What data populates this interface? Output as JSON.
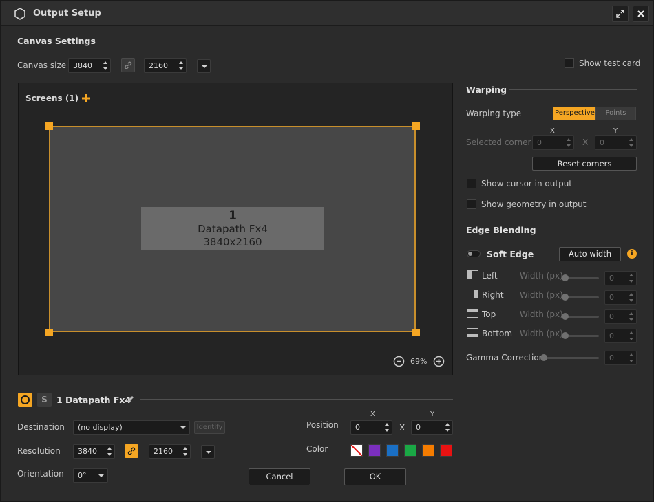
{
  "window": {
    "title": "Output Setup"
  },
  "canvas_settings": {
    "title": "Canvas Settings",
    "canvas_size_label": "Canvas size",
    "width": "3840",
    "height": "2160",
    "show_test_card_label": "Show test card"
  },
  "screens": {
    "title": "Screens (1)",
    "screen": {
      "number": "1",
      "name": "Datapath Fx4",
      "resolution": "3840x2160"
    },
    "zoom": "69%"
  },
  "warping": {
    "title": "Warping",
    "type_label": "Warping type",
    "type_options": [
      "Perspective",
      "Points"
    ],
    "selected_corner_label": "Selected corner",
    "x_header": "X",
    "y_header": "Y",
    "x_value": "0",
    "y_value": "0",
    "x_sep": "X",
    "reset_corners": "Reset corners",
    "show_cursor": "Show cursor in output",
    "show_geometry": "Show geometry in output"
  },
  "edge_blending": {
    "title": "Edge Blending",
    "soft_edge_label": "Soft Edge",
    "auto_width": "Auto width",
    "edges": [
      {
        "label": "Left",
        "width_label": "Width (px)",
        "value": "0"
      },
      {
        "label": "Right",
        "width_label": "Width (px)",
        "value": "0"
      },
      {
        "label": "Top",
        "width_label": "Width (px)",
        "value": "0"
      },
      {
        "label": "Bottom",
        "width_label": "Width (px)",
        "value": "0"
      }
    ],
    "gamma_label": "Gamma Correction",
    "gamma_value": "0"
  },
  "screen_props": {
    "title": "1 Datapath Fx4",
    "s_button": "S",
    "destination_label": "Destination",
    "destination_value": "(no display)",
    "identify": "Identify",
    "resolution_label": "Resolution",
    "res_width": "3840",
    "res_height": "2160",
    "orientation_label": "Orientation",
    "orientation_value": "0°",
    "position_label": "Position",
    "pos_x_header": "X",
    "pos_y_header": "Y",
    "pos_x": "0",
    "pos_y": "0",
    "pos_sep": "X",
    "color_label": "Color",
    "colors": [
      "#7b2fbe",
      "#1a6fc4",
      "#1aa845",
      "#f57c00",
      "#e81212"
    ]
  },
  "footer": {
    "cancel": "Cancel",
    "ok": "OK"
  }
}
